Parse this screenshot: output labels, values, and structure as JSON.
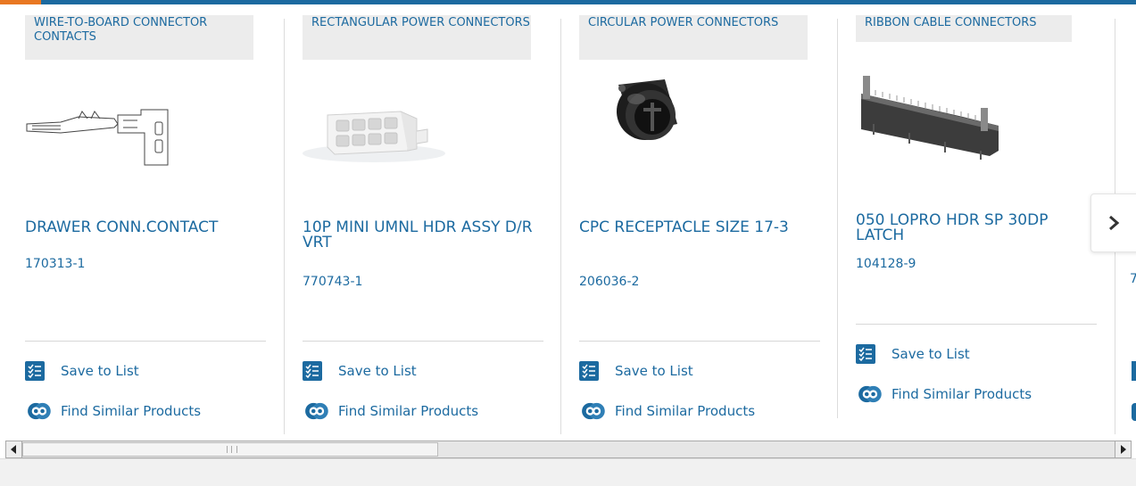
{
  "colors": {
    "accent": "#1c6aa0",
    "orange": "#e87722",
    "tag_bg": "#ececec"
  },
  "cards": [
    {
      "category": "WIRE-TO-BOARD CONNECTOR CONTACTS",
      "name": "DRAWER CONN.CONTACT",
      "part_number": "170313-1",
      "image_icon": "crimp-contact-image"
    },
    {
      "category": "RECTANGULAR POWER CONNECTORS",
      "name": "10P MINI UMNL HDR ASSY D/R VRT",
      "part_number": "770743-1",
      "image_icon": "rectangular-connector-image"
    },
    {
      "category": "CIRCULAR POWER CONNECTORS",
      "name": "CPC RECEPTACLE SIZE 17-3",
      "part_number": "206036-2",
      "image_icon": "circular-connector-image"
    },
    {
      "category": "RIBBON CABLE CONNECTORS",
      "name": "050 LOPRO HDR SP 30DP LATCH",
      "part_number": "104128-9",
      "image_icon": "ribbon-header-image"
    }
  ],
  "actions": {
    "save_label": "Save to List",
    "similar_label": "Find Similar Products"
  },
  "carousel": {
    "next_icon": "chevron-right-icon",
    "peek_text": "7"
  },
  "scrollbar": {
    "left_icon": "arrow-left-icon",
    "right_icon": "arrow-right-icon"
  }
}
